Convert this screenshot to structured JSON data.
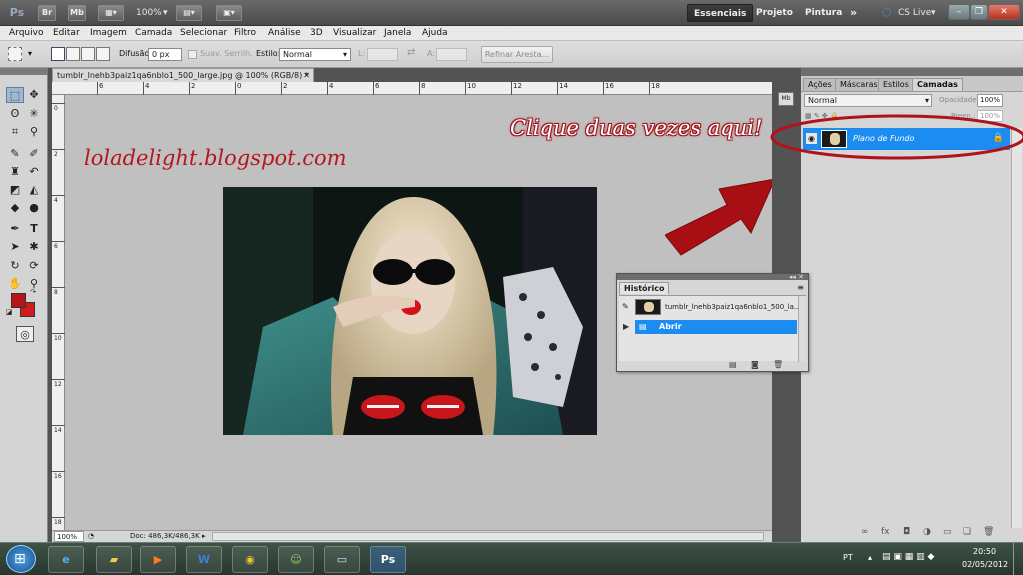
{
  "app": {
    "logo": "Ps",
    "bridge_label": "Br",
    "minibridge_label": "Mb",
    "zoom": "100%",
    "workspaces": [
      "Essenciais",
      "Projeto",
      "Pintura"
    ],
    "more": "»",
    "cs_live": "CS Live"
  },
  "menu": [
    "Arquivo",
    "Editar",
    "Imagem",
    "Camada",
    "Selecionar",
    "Filtro",
    "Análise",
    "3D",
    "Visualizar",
    "Janela",
    "Ajuda"
  ],
  "options": {
    "feather_label": "Difusão:",
    "feather_value": "0 px",
    "antialias_label": "Suav. Serrilh.",
    "style_label": "Estilo:",
    "style_value": "Normal",
    "width_label": "L:",
    "height_label": "A:",
    "refine_label": "Refinar Aresta..."
  },
  "document": {
    "tab_title": "tumblr_lnehb3paiz1qa6nblo1_500_large.jpg @ 100% (RGB/8) *",
    "zoom": "100%",
    "doc_size": "Doc: 486,3K/486,3K",
    "ruler_h": [
      "6",
      "4",
      "2",
      "0",
      "2",
      "4",
      "6",
      "8",
      "10",
      "12",
      "14",
      "16",
      "18"
    ],
    "ruler_v": [
      "0",
      "2",
      "4",
      "6",
      "8",
      "10",
      "12",
      "14",
      "16",
      "18"
    ]
  },
  "colors": {
    "foreground": "#b8141a",
    "background": "#d01c1c",
    "layer_selected": "#1c8cf0",
    "annotation_red": "#b5161c"
  },
  "layers_panel": {
    "tabs": [
      "Ações",
      "Máscaras",
      "Estilos",
      "Camadas"
    ],
    "blend_mode": "Normal",
    "opacity_label": "Opacidade:",
    "opacity_value": "100%",
    "fill_label": "Preen.:",
    "fill_value": "100%",
    "layer_name": "Plano de Fundo"
  },
  "history_panel": {
    "title": "Histórico",
    "snapshot_name": "tumblr_lnehb3paiz1qa6nblo1_500_la...",
    "step": "Abrir"
  },
  "annotations": {
    "watermark": "loladelight.blogspot.com",
    "callout": "Clique duas vezes aqui!"
  },
  "taskbar": {
    "lang": "PT",
    "time": "20:50",
    "date": "02/05/2012",
    "ps_label": "Ps"
  }
}
